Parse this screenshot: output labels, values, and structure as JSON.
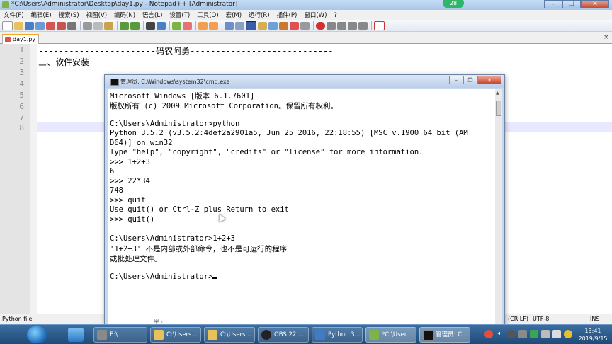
{
  "window": {
    "title": "*C:\\Users\\Administrator\\Desktop\\day1.py - Notepad++ [Administrator]",
    "badge": "28"
  },
  "menu": [
    "文件(F)",
    "编辑(E)",
    "搜索(S)",
    "视图(V)",
    "编码(N)",
    "语言(L)",
    "设置(T)",
    "工具(O)",
    "宏(M)",
    "运行(R)",
    "插件(P)",
    "窗口(W)",
    "?"
  ],
  "tab": {
    "label": "day1.py",
    "close": "×"
  },
  "editor": {
    "line_numbers": [
      "1",
      "2",
      "3",
      "4",
      "5",
      "6",
      "7",
      "8"
    ],
    "lines": [
      "-----------------------码农阿勇----------------------------",
      "三、软件安装"
    ]
  },
  "status": {
    "filetype": "Python file",
    "eol": "(CR LF)",
    "encoding": "UTF-8",
    "mode": "INS"
  },
  "cmd": {
    "title": "管理员: C:\\Windows\\system32\\cmd.exe",
    "lines": [
      "Microsoft Windows [版本 6.1.7601]",
      "版权所有 (c) 2009 Microsoft Corporation。保留所有权利。",
      "",
      "C:\\Users\\Administrator>python",
      "Python 3.5.2 (v3.5.2:4def2a2901a5, Jun 25 2016, 22:18:55) [MSC v.1900 64 bit (AM",
      "D64)] on win32",
      "Type \"help\", \"copyright\", \"credits\" or \"license\" for more information.",
      ">>> 1+2+3",
      "6",
      ">>> 22*34",
      "748",
      ">>> quit",
      "Use quit() or Ctrl-Z plus Return to exit",
      ">>> quit()",
      "",
      "C:\\Users\\Administrator>1+2+3",
      "'1+2+3' 不是内部或外部命令，也不是可运行的程序",
      "或批处理文件。",
      "",
      "C:\\Users\\Administrator>"
    ]
  },
  "ime_text": "半 ·",
  "taskbar": {
    "tasks": [
      {
        "label": "E:\\",
        "color": "#8a8a8a"
      },
      {
        "label": "C:\\Users...",
        "color": "#e8c15a"
      },
      {
        "label": "C:\\Users...",
        "color": "#e8c15a"
      },
      {
        "label": "OBS 22....",
        "color": "#222222"
      },
      {
        "label": "Python 3...",
        "color": "#3f7cc4"
      },
      {
        "label": "*C:\\User...",
        "color": "#7fb24a"
      },
      {
        "label": "管理员: C...",
        "color": "#111111"
      }
    ],
    "clock_time": "13:41",
    "clock_date": "2019/9/15"
  }
}
